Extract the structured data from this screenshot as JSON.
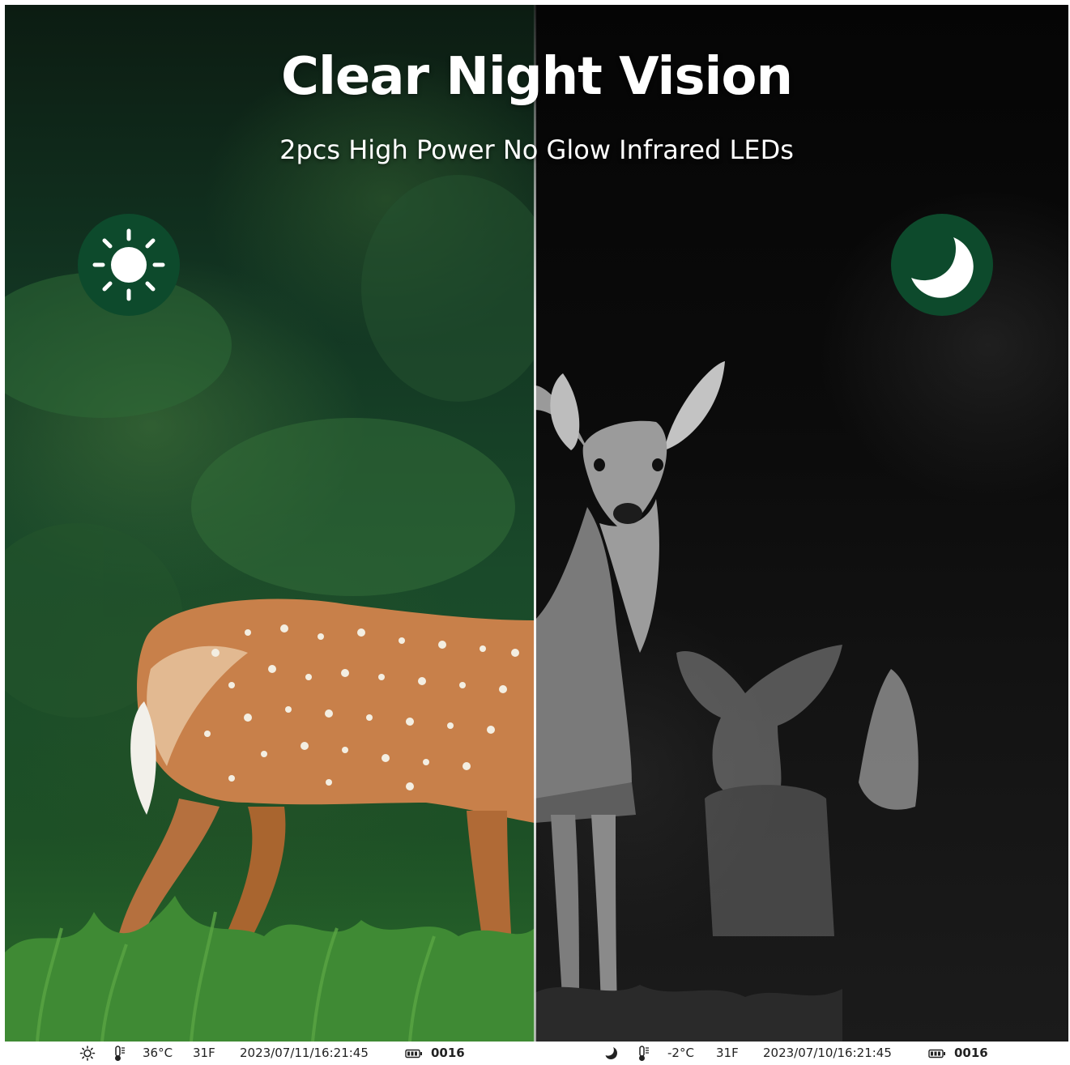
{
  "headline": "Clear Night Vision",
  "subline": "2pcs High Power No Glow Infrared LEDs",
  "badges": {
    "day_icon": "sun-icon",
    "night_icon": "moon-icon",
    "color": "#0d4a2c"
  },
  "status_day": {
    "mode_icon": "sun-icon",
    "thermo_icon": "thermometer-icon",
    "temp_c": "36°C",
    "temp_f": "31F",
    "datetime": "2023/07/11/16:21:45",
    "battery_icon": "battery-icon",
    "counter": "0016"
  },
  "status_night": {
    "mode_icon": "moon-icon",
    "thermo_icon": "thermometer-icon",
    "temp_c": "-2°C",
    "temp_f": "31F",
    "datetime": "2023/07/10/16:21:45",
    "battery_icon": "battery-icon",
    "counter": "0016"
  }
}
